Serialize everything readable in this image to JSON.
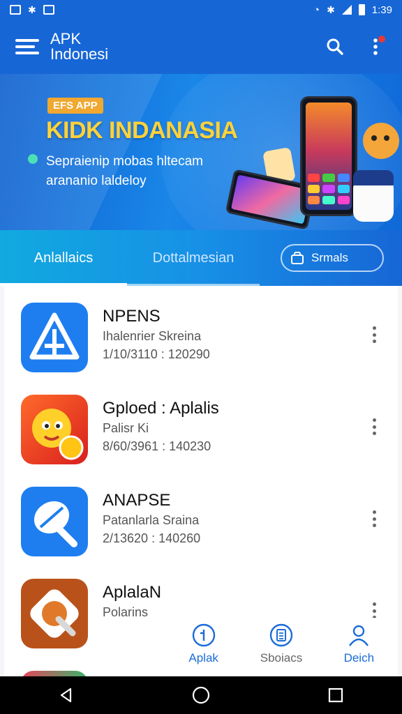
{
  "status_bar": {
    "time": "1:39"
  },
  "app_bar": {
    "title": "APK Indonesi"
  },
  "banner": {
    "badge": "EFS APP",
    "title": "KIDK INDANASIA",
    "subtitle_line1": "Sepraienip mobas hltecam",
    "subtitle_line2": "arananio laldeloy"
  },
  "tabs": [
    {
      "label": "Anlallaics",
      "active": true
    },
    {
      "label": "Dottalmesian",
      "active": false
    }
  ],
  "search": {
    "label": "Srmals"
  },
  "apps": [
    {
      "name": "NPENS",
      "subtitle": "Ihalenrier Skreina",
      "meta": "1/10/3110 : 120290",
      "icon": "tent-icon"
    },
    {
      "name": "Gploed : Aplalis",
      "subtitle": "Palisr Ki",
      "meta": "8/60/3961 : 140230",
      "icon": "mascot-icon"
    },
    {
      "name": "ANAPSE",
      "subtitle": "Patanlarla Sraina",
      "meta": "2/13620 : 140260",
      "icon": "leaf-icon"
    },
    {
      "name": "AplalaN",
      "subtitle": "Polarins",
      "meta": "",
      "icon": "gear-icon"
    }
  ],
  "bottom_nav": [
    {
      "label": "Aplak",
      "icon": "info-icon"
    },
    {
      "label": "Sboiacs",
      "icon": "list-icon"
    },
    {
      "label": "Deich",
      "icon": "person-icon"
    }
  ],
  "colors": {
    "primary": "#1766d6",
    "banner_title": "#ffd23a",
    "badge": "#f0a830",
    "accent_dot": "#4ce0b4"
  }
}
